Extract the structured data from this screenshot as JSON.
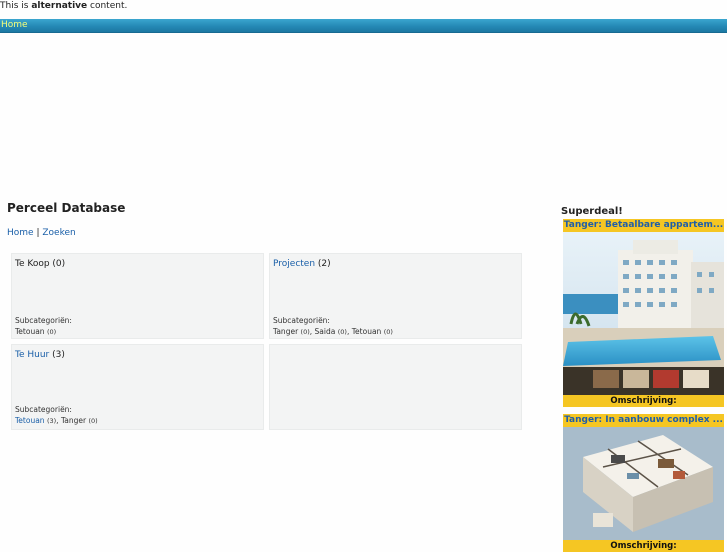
{
  "alt": {
    "prefix": "This is ",
    "bold": "alternative",
    "suffix": " content."
  },
  "nav": {
    "home": "Home"
  },
  "page": {
    "title": "Perceel Database"
  },
  "breadcrumb": {
    "home": "Home",
    "sep": "|",
    "search": "Zoeken"
  },
  "categories": [
    {
      "name": "Te Koop",
      "count": "(0)",
      "sub_label": "Subcategoriën:",
      "subs": [
        {
          "name": "Tetouan",
          "count": "(0)"
        }
      ]
    },
    {
      "name": "Projecten",
      "count": "(2)",
      "sub_label": "Subcategoriën:",
      "subs": [
        {
          "name": "Tanger",
          "count": "(0)"
        },
        {
          "name": "Saida",
          "count": "(0)"
        },
        {
          "name": "Tetouan",
          "count": "(0)"
        }
      ]
    },
    {
      "name": "Te Huur",
      "count": "(3)",
      "sub_label": "Subcategoriën:",
      "subs": [
        {
          "name": "Tetouan",
          "count": "(3)"
        },
        {
          "name": "Tanger",
          "count": "(0)"
        }
      ]
    }
  ],
  "sidebar": {
    "title": "Superdeal!",
    "deals": [
      {
        "title": "Tanger: Betaalbare appartem...",
        "desc_label": "Omschrijving:"
      },
      {
        "title": "Tanger: In aanbouw complex ...",
        "desc_label": "Omschrijving:"
      }
    ]
  },
  "colors": {
    "nav": "#2589b5",
    "nav_text": "#f5ff7a",
    "link": "#1a5fa8",
    "deal_bg": "#f5c623",
    "box_bg": "#f3f4f4"
  }
}
